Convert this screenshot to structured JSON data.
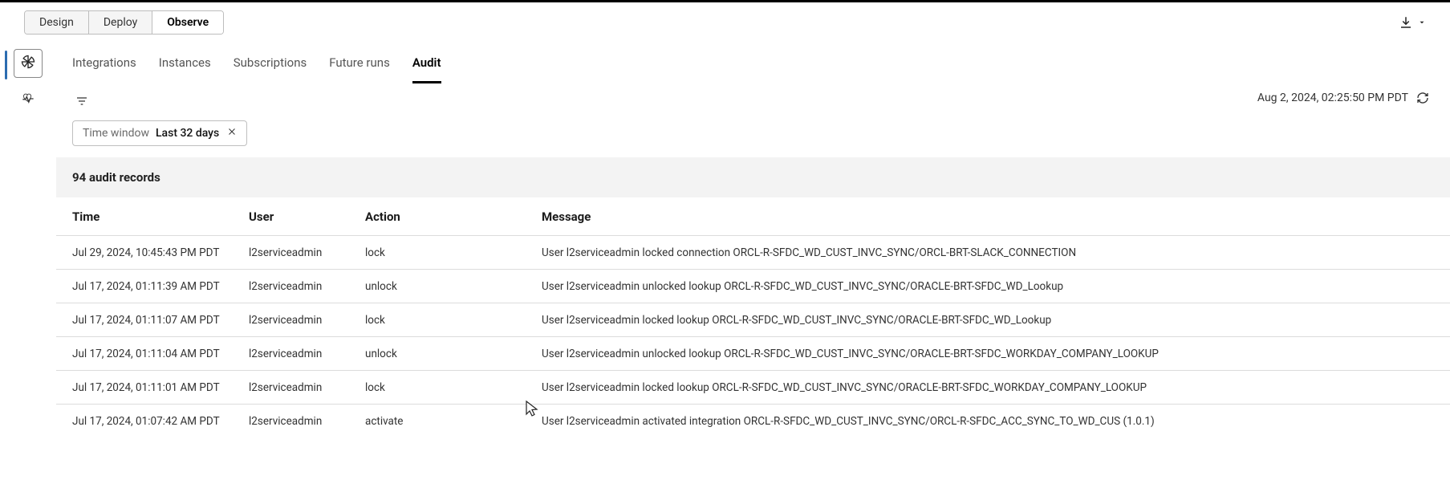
{
  "mode_tabs": {
    "design": "Design",
    "deploy": "Deploy",
    "observe": "Observe",
    "active": "observe"
  },
  "sub_tabs": {
    "integrations": "Integrations",
    "instances": "Instances",
    "subscriptions": "Subscriptions",
    "future_runs": "Future runs",
    "audit": "Audit",
    "active": "audit"
  },
  "page_timestamp": "Aug 2, 2024, 02:25:50 PM PDT",
  "filter_chip": {
    "label": "Time window",
    "value": "Last 32 days"
  },
  "records_summary": "94 audit records",
  "table": {
    "columns": {
      "time": "Time",
      "user": "User",
      "action": "Action",
      "message": "Message"
    },
    "rows": [
      {
        "time": "Jul 29, 2024, 10:45:43 PM PDT",
        "user": "l2serviceadmin",
        "action": "lock",
        "message": "User l2serviceadmin locked connection ORCL-R-SFDC_WD_CUST_INVC_SYNC/ORCL-BRT-SLACK_CONNECTION"
      },
      {
        "time": "Jul 17, 2024, 01:11:39 AM PDT",
        "user": "l2serviceadmin",
        "action": "unlock",
        "message": "User l2serviceadmin unlocked lookup ORCL-R-SFDC_WD_CUST_INVC_SYNC/ORACLE-BRT-SFDC_WD_Lookup"
      },
      {
        "time": "Jul 17, 2024, 01:11:07 AM PDT",
        "user": "l2serviceadmin",
        "action": "lock",
        "message": "User l2serviceadmin locked lookup ORCL-R-SFDC_WD_CUST_INVC_SYNC/ORACLE-BRT-SFDC_WD_Lookup"
      },
      {
        "time": "Jul 17, 2024, 01:11:04 AM PDT",
        "user": "l2serviceadmin",
        "action": "unlock",
        "message": "User l2serviceadmin unlocked lookup ORCL-R-SFDC_WD_CUST_INVC_SYNC/ORACLE-BRT-SFDC_WORKDAY_COMPANY_LOOKUP"
      },
      {
        "time": "Jul 17, 2024, 01:11:01 AM PDT",
        "user": "l2serviceadmin",
        "action": "lock",
        "message": "User l2serviceadmin locked lookup ORCL-R-SFDC_WD_CUST_INVC_SYNC/ORACLE-BRT-SFDC_WORKDAY_COMPANY_LOOKUP"
      },
      {
        "time": "Jul 17, 2024, 01:07:42 AM PDT",
        "user": "l2serviceadmin",
        "action": "activate",
        "message": "User l2serviceadmin activated integration ORCL-R-SFDC_WD_CUST_INVC_SYNC/ORCL-R-SFDC_ACC_SYNC_TO_WD_CUS (1.0.1)"
      }
    ]
  }
}
